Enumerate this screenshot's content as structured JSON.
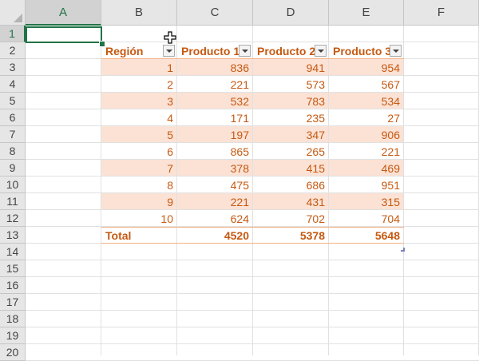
{
  "columns": [
    "A",
    "B",
    "C",
    "D",
    "E",
    "F"
  ],
  "rows": [
    "1",
    "2",
    "3",
    "4",
    "5",
    "6",
    "7",
    "8",
    "9",
    "10",
    "11",
    "12",
    "13",
    "14",
    "15",
    "16",
    "17",
    "18",
    "19",
    "20"
  ],
  "selected_cell": "A1",
  "table": {
    "headers": [
      "Región",
      "Producto 1",
      "Producto 2",
      "Producto 3"
    ],
    "data": [
      [
        "1",
        "836",
        "941",
        "954"
      ],
      [
        "2",
        "221",
        "573",
        "567"
      ],
      [
        "3",
        "532",
        "783",
        "534"
      ],
      [
        "4",
        "171",
        "235",
        "27"
      ],
      [
        "5",
        "197",
        "347",
        "906"
      ],
      [
        "6",
        "865",
        "265",
        "221"
      ],
      [
        "7",
        "378",
        "415",
        "469"
      ],
      [
        "8",
        "475",
        "686",
        "951"
      ],
      [
        "9",
        "221",
        "431",
        "315"
      ],
      [
        "10",
        "624",
        "702",
        "704"
      ]
    ],
    "total": [
      "Total",
      "4520",
      "5378",
      "5648"
    ]
  },
  "colors": {
    "accent": "#217346",
    "table_text": "#c65911",
    "band": "#fbe2d5",
    "rule": "#f4b183"
  },
  "icons": [
    "filter-dropdown-icon",
    "move-cursor-icon",
    "fill-handle",
    "table-resize-handle"
  ]
}
